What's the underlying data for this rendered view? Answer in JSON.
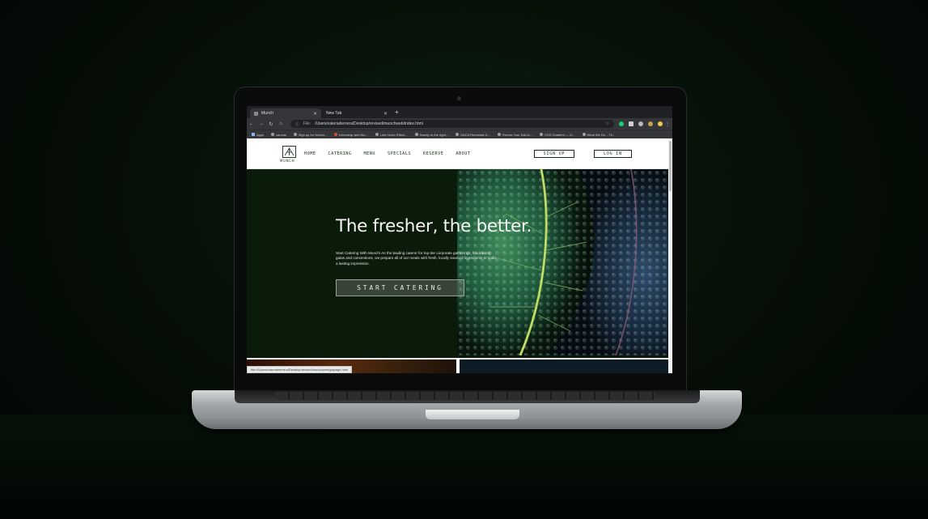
{
  "browser": {
    "tabs": [
      {
        "title": "Munch"
      },
      {
        "title": "New Tab"
      }
    ],
    "new_tab_icon": "+",
    "address": {
      "scheme_label": "File",
      "url": "/Users/valeriaherrera/Desktop/revised/munchweb/index.html"
    },
    "bookmarks": [
      {
        "label": "Apps",
        "icon": "apps-grid-icon"
      },
      {
        "label": "canvas",
        "icon": "globe-icon"
      },
      {
        "label": "Sign up for Worka...",
        "icon": "globe-icon"
      },
      {
        "label": "Internship and Wo...",
        "icon": "globe-icon-red"
      },
      {
        "label": "Link Hover Effect...",
        "icon": "globe-icon"
      },
      {
        "label": "Sweep to the right...",
        "icon": "globe-icon"
      },
      {
        "label": "DACA Renewals D...",
        "icon": "globe-icon"
      },
      {
        "label": "Renew Your DACA...",
        "icon": "globe-icon"
      },
      {
        "label": "CSS Gradient — G...",
        "icon": "globe-icon"
      },
      {
        "label": "What We Do – Th...",
        "icon": "globe-icon"
      }
    ],
    "status_bar_url": "file:///Users/valeriaherrera/Desktop/revised/munchweb/galpage.html"
  },
  "site": {
    "logo_text": "MUNCH",
    "nav": [
      "HOME",
      "CATERING",
      "MENU",
      "SPECIALS",
      "RESERVE",
      "ABOUT"
    ],
    "signup_label": "SIGN UP",
    "login_label": "LOG IN",
    "hero": {
      "title": "The fresher, the better.",
      "body": "Start Catering With Munch! As the leading caterer for top-tier corporate gatherings, fundraising galas and conventions, we prepare all of our meals with fresh, locally sourced ingredients to make a lasting impression.",
      "cta_label": "START CATERING"
    }
  },
  "colors": {
    "hero_bg": "#0b1b09",
    "leaf_green": "#2f6a45",
    "accent_stem": "#a6c94a"
  }
}
